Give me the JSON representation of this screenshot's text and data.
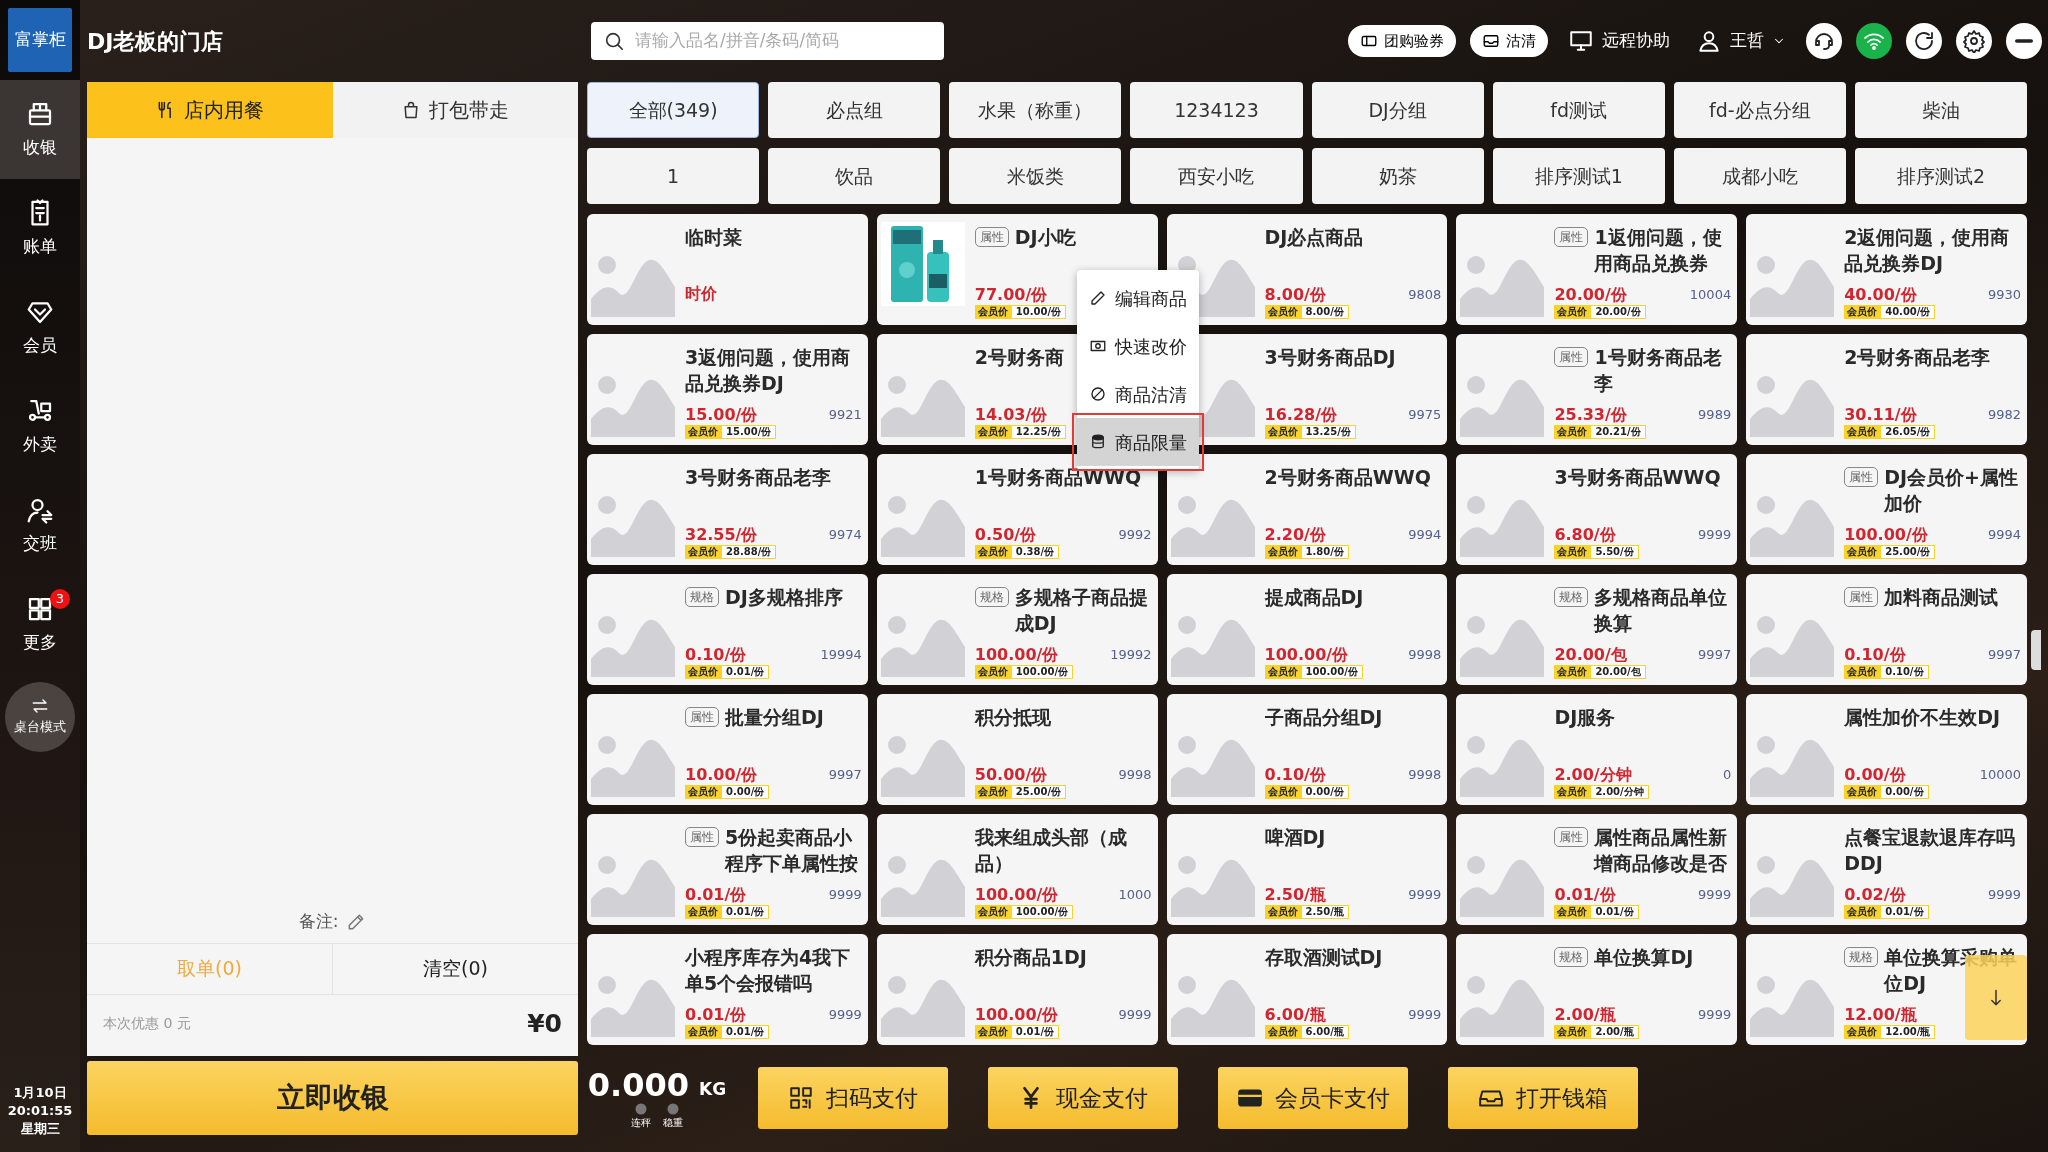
{
  "app": {
    "logo": "富掌柜",
    "store_name": "DJ老板的门店"
  },
  "search": {
    "placeholder": "请输入品名/拼音/条码/简码"
  },
  "toolbar": [
    {
      "label": "团购验券",
      "kind": "coupon"
    },
    {
      "label": "沽清",
      "kind": "soldout"
    },
    {
      "label": "远程协助",
      "kind": "remote"
    }
  ],
  "user": {
    "name": "王哲"
  },
  "nav": [
    {
      "label": "收银",
      "kind": "cashier",
      "selected": true
    },
    {
      "label": "账单",
      "kind": "bill",
      "selected": false
    },
    {
      "label": "会员",
      "kind": "member",
      "selected": false
    },
    {
      "label": "外卖",
      "kind": "delivery",
      "selected": false
    },
    {
      "label": "交班",
      "kind": "shift",
      "selected": false
    },
    {
      "label": "更多",
      "kind": "more",
      "selected": false,
      "badge": "3"
    }
  ],
  "mode_button": {
    "label": "桌台模式"
  },
  "clock": {
    "date": "1月10日",
    "time": "20:01:55",
    "weekday": "星期三"
  },
  "order_tabs": [
    {
      "label": "店内用餐",
      "kind": "dine",
      "selected": true
    },
    {
      "label": "打包带走",
      "kind": "takeaway",
      "selected": false
    }
  ],
  "order": {
    "remark_label": "备注:",
    "actions": [
      {
        "label": "取单(0)",
        "kind": "recall"
      },
      {
        "label": "清空(0)",
        "kind": "clear"
      }
    ],
    "discount": "本次优惠 0 元",
    "total": "¥0"
  },
  "checkout": {
    "label": "立即收银"
  },
  "scale": {
    "weight": "0.000",
    "unit": "KG",
    "indicators": [
      "连秤",
      "稳重"
    ]
  },
  "payments": [
    {
      "label": "扫码支付",
      "kind": "qr"
    },
    {
      "label": "现金支付",
      "kind": "cash"
    },
    {
      "label": "会员卡支付",
      "kind": "card"
    },
    {
      "label": "打开钱箱",
      "kind": "drawer"
    }
  ],
  "categories": [
    {
      "label": "全部(349)",
      "selected": true
    },
    {
      "label": "必点组",
      "selected": false
    },
    {
      "label": "水果（称重）",
      "selected": false
    },
    {
      "label": "1234123",
      "selected": false
    },
    {
      "label": "DJ分组",
      "selected": false
    },
    {
      "label": "fd测试",
      "selected": false
    },
    {
      "label": "fd-必点分组",
      "selected": false
    },
    {
      "label": "柴油",
      "selected": false
    },
    {
      "label": "1",
      "selected": false
    },
    {
      "label": "饮品",
      "selected": false
    },
    {
      "label": "米饭类",
      "selected": false
    },
    {
      "label": "西安小吃",
      "selected": false
    },
    {
      "label": "奶茶",
      "selected": false
    },
    {
      "label": "排序测试1",
      "selected": false
    },
    {
      "label": "成都小吃",
      "selected": false
    },
    {
      "label": "排序测试2",
      "selected": false
    }
  ],
  "products": [
    {
      "name": "临时菜",
      "kind": "placeholder",
      "price": "时价"
    },
    {
      "name": "DJ小吃",
      "kind": "picture",
      "tag": "属性",
      "price": "77.00/份",
      "member_label": "会员价",
      "member_price": "10.00/份"
    },
    {
      "name": "DJ必点商品",
      "kind": "placeholder",
      "price": "8.00/份",
      "member_label": "会员价",
      "member_price": "8.00/份",
      "stock": "9808"
    },
    {
      "name": "1返佣问题，使用商品兑换券",
      "kind": "placeholder",
      "tag": "属性",
      "price": "20.00/份",
      "member_label": "会员价",
      "member_price": "20.00/份",
      "stock": "10004"
    },
    {
      "name": "2返佣问题，使用商品兑换券DJ",
      "kind": "placeholder",
      "price": "40.00/份",
      "member_label": "会员价",
      "member_price": "40.00/份",
      "stock": "9930"
    },
    {
      "name": "3返佣问题，使用商品兑换券DJ",
      "kind": "placeholder",
      "price": "15.00/份",
      "member_label": "会员价",
      "member_price": "15.00/份",
      "stock": "9921"
    },
    {
      "name": "2号财务商",
      "kind": "placeholder",
      "price": "14.03/份",
      "member_label": "会员价",
      "member_price": "12.25/份"
    },
    {
      "name": "3号财务商品DJ",
      "kind": "placeholder",
      "price": "16.28/份",
      "member_label": "会员价",
      "member_price": "13.25/份",
      "stock": "9975"
    },
    {
      "name": "1号财务商品老李",
      "kind": "placeholder",
      "tag": "属性",
      "price": "25.33/份",
      "member_label": "会员价",
      "member_price": "20.21/份",
      "stock": "9989"
    },
    {
      "name": "2号财务商品老李",
      "kind": "placeholder",
      "price": "30.11/份",
      "member_label": "会员价",
      "member_price": "26.05/份",
      "stock": "9982"
    },
    {
      "name": "3号财务商品老李",
      "kind": "placeholder",
      "price": "32.55/份",
      "member_label": "会员价",
      "member_price": "28.88/份",
      "stock": "9974"
    },
    {
      "name": "1号财务商品WWQ",
      "kind": "placeholder",
      "price": "0.50/份",
      "member_label": "会员价",
      "member_price": "0.38/份",
      "stock": "9992"
    },
    {
      "name": "2号财务商品WWQ",
      "kind": "placeholder",
      "price": "2.20/份",
      "member_label": "会员价",
      "member_price": "1.80/份",
      "stock": "9994"
    },
    {
      "name": "3号财务商品WWQ",
      "kind": "placeholder",
      "price": "6.80/份",
      "member_label": "会员价",
      "member_price": "5.50/份",
      "stock": "9999"
    },
    {
      "name": "DJ会员价+属性加价",
      "kind": "placeholder",
      "tag": "属性",
      "price": "100.00/份",
      "member_label": "会员价",
      "member_price": "25.00/份",
      "stock": "9994"
    },
    {
      "name": "DJ多规格排序",
      "kind": "placeholder",
      "tag": "规格",
      "price": "0.10/份",
      "member_label": "会员价",
      "member_price": "0.01/份",
      "stock": "19994"
    },
    {
      "name": "多规格子商品提成DJ",
      "kind": "placeholder",
      "tag": "规格",
      "price": "100.00/份",
      "member_label": "会员价",
      "member_price": "100.00/份",
      "stock": "19992"
    },
    {
      "name": "提成商品DJ",
      "kind": "placeholder",
      "price": "100.00/份",
      "member_label": "会员价",
      "member_price": "100.00/份",
      "stock": "9998"
    },
    {
      "name": "多规格商品单位换算",
      "kind": "placeholder",
      "tag": "规格",
      "price": "20.00/包",
      "member_label": "会员价",
      "member_price": "20.00/包",
      "stock": "9997"
    },
    {
      "name": "加料商品测试",
      "kind": "placeholder",
      "tag": "属性",
      "price": "0.10/份",
      "member_label": "会员价",
      "member_price": "0.10/份",
      "stock": "9997"
    },
    {
      "name": "批量分组DJ",
      "kind": "placeholder",
      "tag": "属性",
      "price": "10.00/份",
      "member_label": "会员价",
      "member_price": "0.00/份",
      "stock": "9997"
    },
    {
      "name": "积分抵现",
      "kind": "placeholder",
      "price": "50.00/份",
      "member_label": "会员价",
      "member_price": "25.00/份",
      "stock": "9998"
    },
    {
      "name": "子商品分组DJ",
      "kind": "placeholder",
      "price": "0.10/份",
      "member_label": "会员价",
      "member_price": "0.00/份",
      "stock": "9998"
    },
    {
      "name": "DJ服务",
      "kind": "placeholder",
      "price": "2.00/分钟",
      "member_label": "会员价",
      "member_price": "2.00/分钟",
      "stock": "0"
    },
    {
      "name": "属性加价不生效DJ",
      "kind": "placeholder",
      "price": "0.00/份",
      "member_label": "会员价",
      "member_price": "0.00/份",
      "stock": "10000"
    },
    {
      "name": "5份起卖商品小程序下单属性按",
      "kind": "placeholder",
      "tag": "属性",
      "price": "0.01/份",
      "member_label": "会员价",
      "member_price": "0.01/份",
      "stock": "9999"
    },
    {
      "name": "我来组成头部（成品）",
      "kind": "placeholder",
      "price": "100.00/份",
      "member_label": "会员价",
      "member_price": "100.00/份",
      "stock": "1000"
    },
    {
      "name": "啤酒DJ",
      "kind": "placeholder",
      "price": "2.50/瓶",
      "member_label": "会员价",
      "member_price": "2.50/瓶",
      "stock": "9999"
    },
    {
      "name": "属性商品属性新增商品修改是否",
      "kind": "placeholder",
      "tag": "属性",
      "price": "0.01/份",
      "member_label": "会员价",
      "member_price": "0.01/份",
      "stock": "9999"
    },
    {
      "name": "点餐宝退款退库存吗DDJ",
      "kind": "placeholder",
      "price": "0.02/份",
      "member_label": "会员价",
      "member_price": "0.01/份",
      "stock": "9999"
    },
    {
      "name": "小程序库存为4我下单5个会报错吗",
      "kind": "placeholder",
      "price": "0.01/份",
      "member_label": "会员价",
      "member_price": "0.01/份",
      "stock": "9999"
    },
    {
      "name": "积分商品1DJ",
      "kind": "placeholder",
      "price": "100.00/份",
      "member_label": "会员价",
      "member_price": "0.01/份",
      "stock": "9999"
    },
    {
      "name": "存取酒测试DJ",
      "kind": "placeholder",
      "price": "6.00/瓶",
      "member_label": "会员价",
      "member_price": "6.00/瓶",
      "stock": "9999"
    },
    {
      "name": "单位换算DJ",
      "kind": "placeholder",
      "tag": "规格",
      "price": "2.00/瓶",
      "member_label": "会员价",
      "member_price": "2.00/瓶",
      "stock": "9999"
    },
    {
      "name": "单位换算采购单位DJ",
      "kind": "placeholder",
      "tag": "规格",
      "price": "12.00/瓶",
      "member_label": "会员价",
      "member_price": "12.00/瓶"
    }
  ],
  "context_menu": {
    "items": [
      {
        "label": "编辑商品",
        "kind": "edit",
        "selected": false
      },
      {
        "label": "快速改价",
        "kind": "price",
        "selected": false
      },
      {
        "label": "商品沽清",
        "kind": "soldout",
        "selected": false
      },
      {
        "label": "商品限量",
        "kind": "limit",
        "selected": true
      }
    ]
  }
}
